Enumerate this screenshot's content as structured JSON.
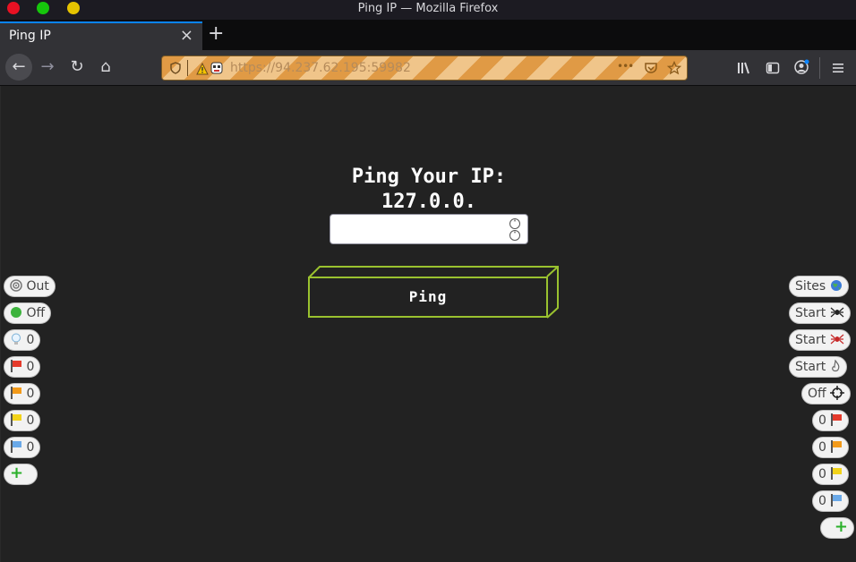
{
  "window": {
    "title": "Ping IP — Mozilla Firefox"
  },
  "tab": {
    "label": "Ping IP",
    "close": "×",
    "new_tab": "+"
  },
  "nav": {
    "back": "←",
    "forward": "→",
    "reload": "↻",
    "home": "⌂",
    "url": "https://94.237.62.195:59982",
    "menu_dots": "•••"
  },
  "page": {
    "heading_line1": "Ping Your IP:",
    "heading_line2": "127.0.0.",
    "input_value": "",
    "ping_label": "Ping"
  },
  "left_toolbar": [
    {
      "label": "Out",
      "icon": "target-icon"
    },
    {
      "label": "Off",
      "icon": "green-dot-icon"
    },
    {
      "label": "0",
      "icon": "lightbulb-icon"
    },
    {
      "label": "0",
      "icon": "red-flag-icon",
      "color": "#e53a2b"
    },
    {
      "label": "0",
      "icon": "orange-flag-icon",
      "color": "#f29a1a"
    },
    {
      "label": "0",
      "icon": "yellow-flag-icon",
      "color": "#f2d31a"
    },
    {
      "label": "0",
      "icon": "blue-flag-icon",
      "color": "#6aa9e8"
    },
    {
      "label": "+",
      "icon": "add-icon"
    }
  ],
  "right_toolbar": [
    {
      "label": "Sites",
      "icon": "globe-icon"
    },
    {
      "label": "Start",
      "icon": "spider-icon"
    },
    {
      "label": "Start",
      "icon": "red-spider-icon"
    },
    {
      "label": "Start",
      "icon": "flame-icon"
    },
    {
      "label": "Off",
      "icon": "crosshair-icon"
    },
    {
      "label": "0",
      "icon": "red-flag-icon",
      "color": "#e53a2b"
    },
    {
      "label": "0",
      "icon": "orange-flag-icon",
      "color": "#f29a1a"
    },
    {
      "label": "0",
      "icon": "yellow-flag-icon",
      "color": "#f2d31a"
    },
    {
      "label": "0",
      "icon": "blue-flag-icon",
      "color": "#6aa9e8"
    },
    {
      "label": "+",
      "icon": "add-icon"
    }
  ]
}
